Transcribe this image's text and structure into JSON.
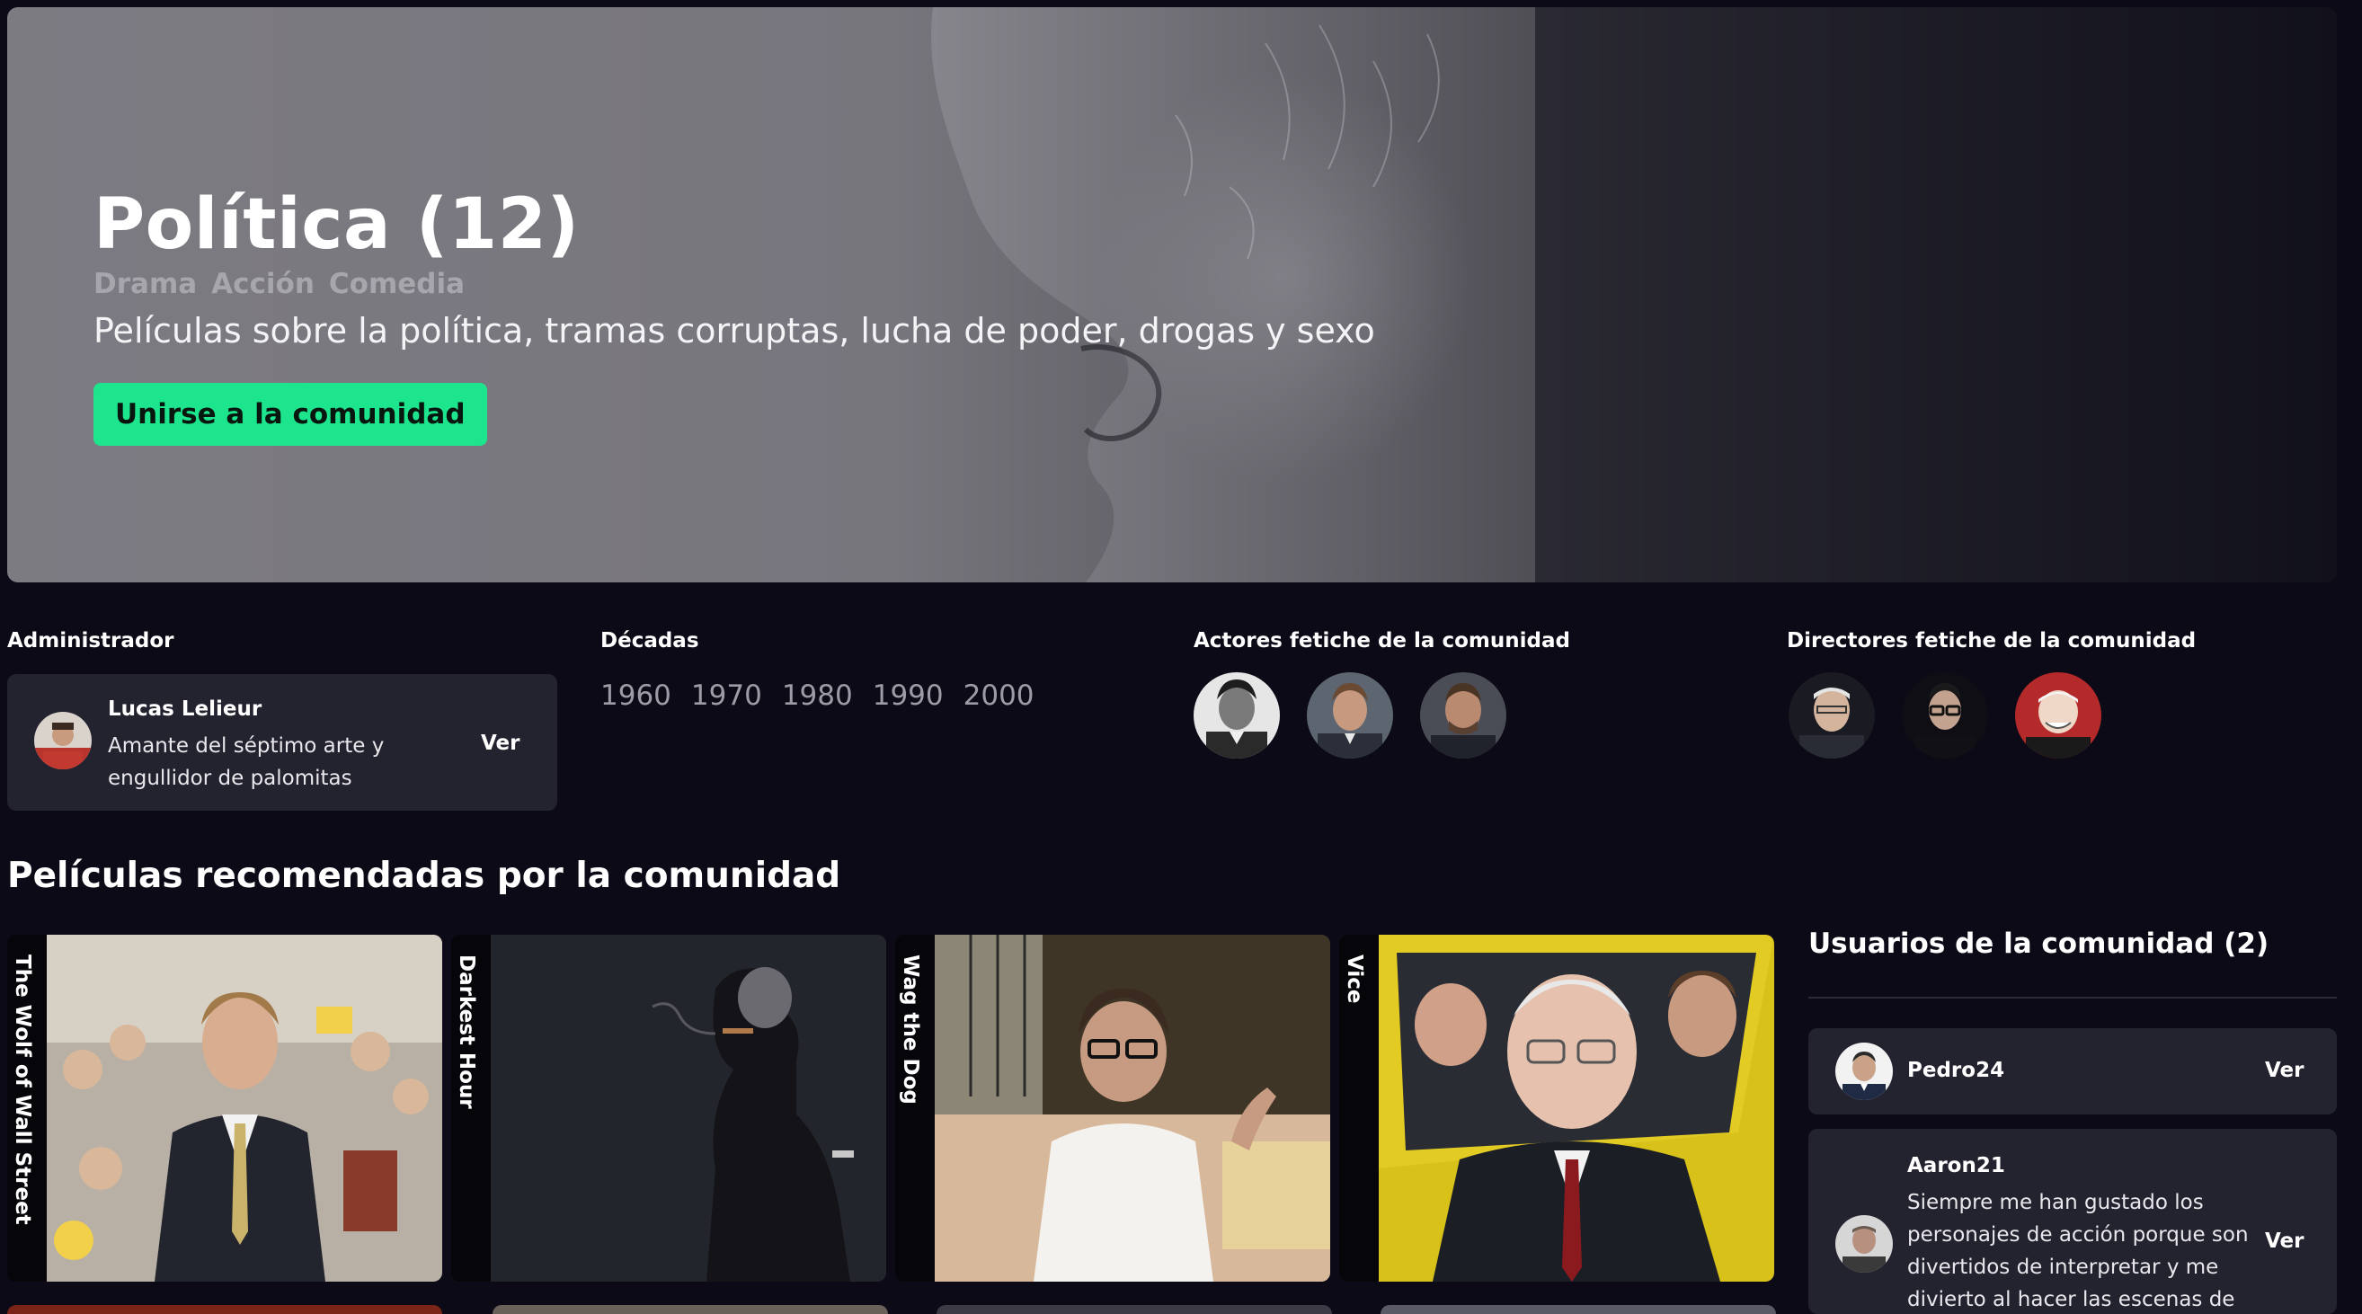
{
  "hero": {
    "title": "Política (12)",
    "genres": [
      "Drama",
      "Acción",
      "Comedia"
    ],
    "description": "Películas sobre la política, tramas corruptas, lucha de poder, drogas y sexo",
    "join_label": "Unirse a la comunidad"
  },
  "admin": {
    "label": "Administrador",
    "name": "Lucas Lelieur",
    "bio": "Amante del séptimo arte y engullidor de palomitas",
    "action": "Ver"
  },
  "decades": {
    "label": "Décadas",
    "items": [
      "1960",
      "1970",
      "1980",
      "1990",
      "2000"
    ]
  },
  "actors": {
    "label": "Actores fetiche de la comunidad"
  },
  "directors": {
    "label": "Directores fetiche de la comunidad"
  },
  "recommended": {
    "title": "Películas recomendadas por la comunidad",
    "movies": [
      {
        "title": "The Wolf of Wall Street"
      },
      {
        "title": "Darkest Hour"
      },
      {
        "title": "Wag the Dog"
      },
      {
        "title": "Vice"
      }
    ]
  },
  "users": {
    "title": "Usuarios de la comunidad (2)",
    "items": [
      {
        "name": "Pedro24",
        "bio": "",
        "action": "Ver"
      },
      {
        "name": "Aaron21",
        "bio": "Siempre me han gustado los personajes de acción porque son divertidos de interpretar y me divierto al hacer las escenas de",
        "action": "Ver"
      }
    ]
  },
  "colors": {
    "background": "#0b0a16",
    "accent": "#1de58e",
    "card": "#23222f"
  }
}
